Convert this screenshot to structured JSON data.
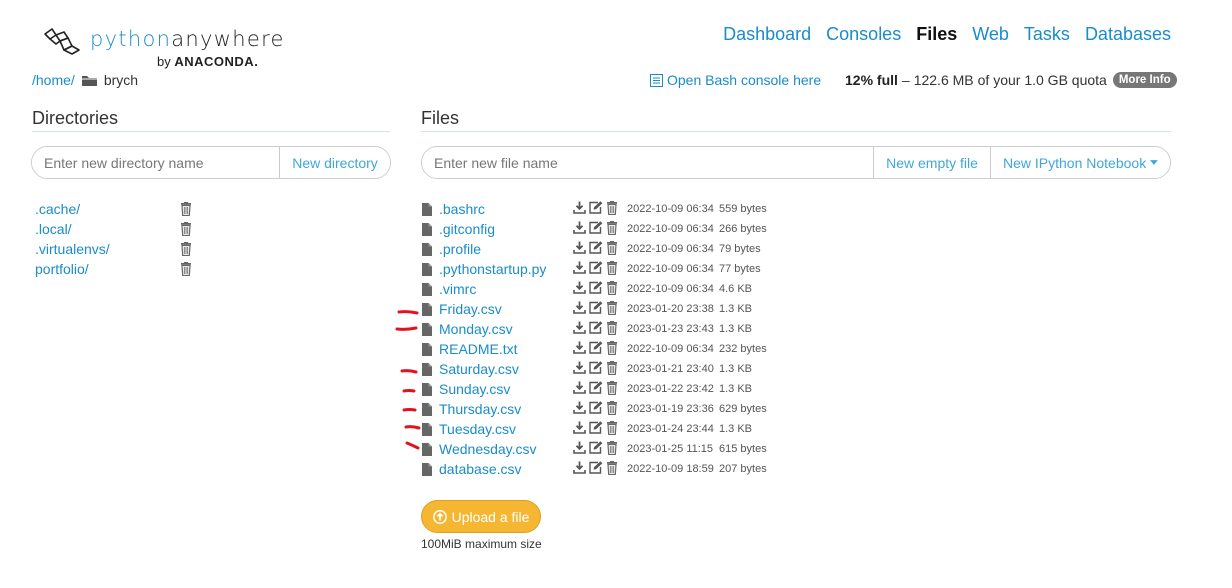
{
  "brand": {
    "name_part1": "python",
    "name_part2": "anywhere",
    "by": "by",
    "company": "ANACONDA."
  },
  "nav": [
    {
      "label": "Dashboard",
      "active": false
    },
    {
      "label": "Consoles",
      "active": false
    },
    {
      "label": "Files",
      "active": true
    },
    {
      "label": "Web",
      "active": false
    },
    {
      "label": "Tasks",
      "active": false
    },
    {
      "label": "Databases",
      "active": false
    }
  ],
  "breadcrumb": {
    "path_link": "/home/",
    "current": "brych"
  },
  "bash_link": "Open Bash console here",
  "quota": {
    "percent": "12% full",
    "dash": "–",
    "used": "122.6 MB",
    "of_text": "of your 1.0 GB quota",
    "more_info": "More Info"
  },
  "directories": {
    "heading": "Directories",
    "input_placeholder": "Enter new directory name",
    "new_button": "New directory",
    "items": [
      ".cache/",
      ".local/",
      ".virtualenvs/",
      "portfolio/"
    ]
  },
  "files": {
    "heading": "Files",
    "input_placeholder": "Enter new file name",
    "new_empty_button": "New empty file",
    "new_notebook_button": "New IPython Notebook",
    "items": [
      {
        "name": ".bashrc",
        "date": "2022-10-09 06:34",
        "size": "559 bytes"
      },
      {
        "name": ".gitconfig",
        "date": "2022-10-09 06:34",
        "size": "266 bytes"
      },
      {
        "name": ".profile",
        "date": "2022-10-09 06:34",
        "size": "79 bytes"
      },
      {
        "name": ".pythonstartup.py",
        "date": "2022-10-09 06:34",
        "size": "77 bytes"
      },
      {
        "name": ".vimrc",
        "date": "2022-10-09 06:34",
        "size": "4.6 KB"
      },
      {
        "name": "Friday.csv",
        "date": "2023-01-20 23:38",
        "size": "1.3 KB"
      },
      {
        "name": "Monday.csv",
        "date": "2023-01-23 23:43",
        "size": "1.3 KB"
      },
      {
        "name": "README.txt",
        "date": "2022-10-09 06:34",
        "size": "232 bytes"
      },
      {
        "name": "Saturday.csv",
        "date": "2023-01-21 23:40",
        "size": "1.3 KB"
      },
      {
        "name": "Sunday.csv",
        "date": "2023-01-22 23:42",
        "size": "1.3 KB"
      },
      {
        "name": "Thursday.csv",
        "date": "2023-01-19 23:36",
        "size": "629 bytes"
      },
      {
        "name": "Tuesday.csv",
        "date": "2023-01-24 23:44",
        "size": "1.3 KB"
      },
      {
        "name": "Wednesday.csv",
        "date": "2023-01-25 11:15",
        "size": "615 bytes"
      },
      {
        "name": "database.csv",
        "date": "2022-10-09 18:59",
        "size": "207 bytes"
      }
    ]
  },
  "upload": {
    "label": "Upload a file",
    "note": "100MiB maximum size"
  },
  "colors": {
    "link": "#1a8cc8",
    "upload": "#f5b731",
    "annotation": "#e0141e"
  },
  "icons": {
    "folder": "folder-icon",
    "file": "file-icon",
    "download": "download-icon",
    "edit": "edit-icon",
    "trash": "trash-icon",
    "terminal": "terminal-icon",
    "upload": "upload-circle-icon"
  }
}
